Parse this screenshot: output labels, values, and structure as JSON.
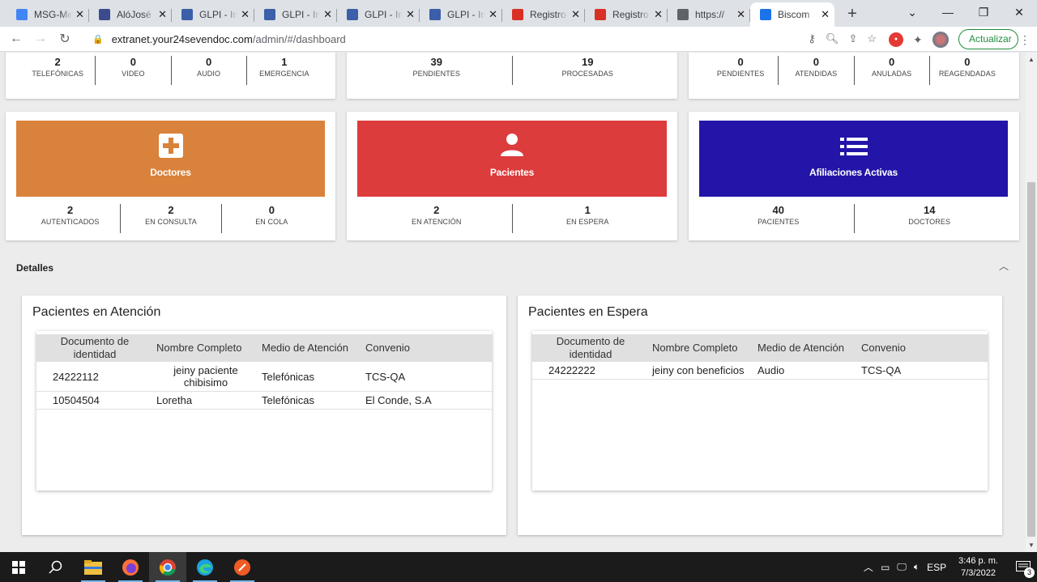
{
  "browser": {
    "tabs": [
      {
        "title": "MSG-Me",
        "favicon_color": "#4285f4",
        "favicon": "docs-icon"
      },
      {
        "title": "AlóJosé",
        "favicon_color": "#3c4a8f",
        "favicon": "doc-icon"
      },
      {
        "title": "GLPI - In",
        "favicon_color": "#3b5fa8",
        "favicon": "glpi-icon"
      },
      {
        "title": "GLPI - In",
        "favicon_color": "#3b5fa8",
        "favicon": "glpi-icon"
      },
      {
        "title": "GLPI - In",
        "favicon_color": "#3b5fa8",
        "favicon": "glpi-icon"
      },
      {
        "title": "GLPI - In",
        "favicon_color": "#3b5fa8",
        "favicon": "glpi-icon"
      },
      {
        "title": "Registro",
        "favicon_color": "#d93025",
        "favicon": "gmail-icon"
      },
      {
        "title": "Registro",
        "favicon_color": "#d93025",
        "favicon": "gmail-icon"
      },
      {
        "title": "https://",
        "favicon_color": "#5f6368",
        "favicon": "globe-icon"
      },
      {
        "title": "Biscom",
        "favicon_color": "#1a73e8",
        "favicon": "biscom-icon",
        "active": true
      }
    ],
    "url_host": "extranet.your24sevendoc.com",
    "url_path": "/admin/#/dashboard",
    "update_label": "Actualizar"
  },
  "top_stats": {
    "card1": [
      {
        "num": "2",
        "label": "TELEFÓNICAS"
      },
      {
        "num": "0",
        "label": "VIDEO"
      },
      {
        "num": "0",
        "label": "AUDIO"
      },
      {
        "num": "1",
        "label": "EMERGENCIA"
      }
    ],
    "card2": [
      {
        "num": "39",
        "label": "PENDIENTES"
      },
      {
        "num": "19",
        "label": "PROCESADAS"
      }
    ],
    "card3": [
      {
        "num": "0",
        "label": "PENDIENTES"
      },
      {
        "num": "0",
        "label": "ATENDIDAS"
      },
      {
        "num": "0",
        "label": "ANULADAS"
      },
      {
        "num": "0",
        "label": "REAGENDADAS"
      }
    ]
  },
  "doctores": {
    "title": "Doctores",
    "color": "#d9823b",
    "stats": [
      {
        "num": "2",
        "label": "AUTENTICADOS"
      },
      {
        "num": "2",
        "label": "EN CONSULTA"
      },
      {
        "num": "0",
        "label": "EN COLA"
      }
    ]
  },
  "pacientes": {
    "title": "Pacientes",
    "color": "#dc3c3c",
    "stats": [
      {
        "num": "2",
        "label": "EN ATENCIÓN"
      },
      {
        "num": "1",
        "label": "EN ESPERA"
      }
    ]
  },
  "afiliaciones": {
    "title": "Afiliaciones Activas",
    "color": "#2315a8",
    "stats": [
      {
        "num": "40",
        "label": "PACIENTES"
      },
      {
        "num": "14",
        "label": "DOCTORES"
      }
    ]
  },
  "details": {
    "title": "Detalles",
    "headers": [
      "Documento de identidad",
      "Nombre Completo",
      "Medio de Atención",
      "Convenio"
    ],
    "atencion": {
      "title": "Pacientes en Atención",
      "rows": [
        [
          "24222112",
          "jeiny paciente chibisimo",
          "Telefónicas",
          "TCS-QA"
        ],
        [
          "10504504",
          "Loretha",
          "Telefónicas",
          "El Conde, S.A"
        ]
      ]
    },
    "espera": {
      "title": "Pacientes en Espera",
      "rows": [
        [
          "24222222",
          "jeiny con beneficios",
          "Audio",
          "TCS-QA"
        ]
      ]
    }
  },
  "taskbar": {
    "lang": "ESP",
    "time": "3:46 p. m.",
    "date": "7/3/2022",
    "notifications": "3"
  }
}
